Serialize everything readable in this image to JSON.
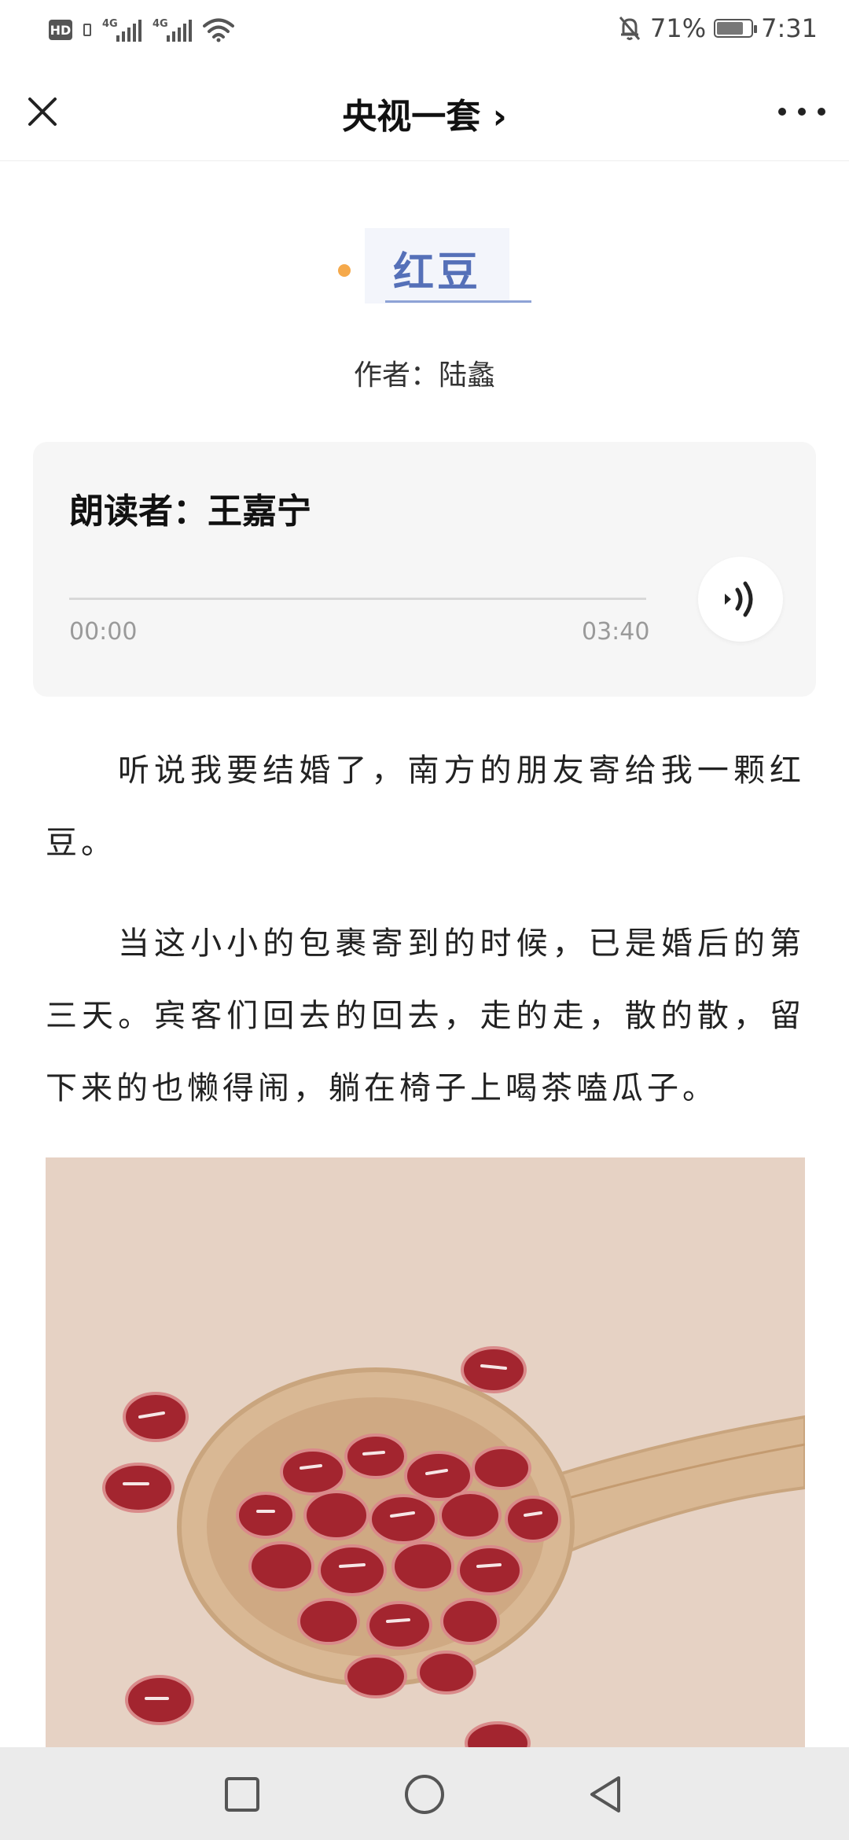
{
  "status_bar": {
    "hd_label": "HD",
    "sim1_label": "4G",
    "sim2_label": "4G",
    "battery_percent": "71%",
    "time": "7:31"
  },
  "header": {
    "title": "央视一套",
    "title_chevron": "›"
  },
  "article": {
    "title": "红豆",
    "author": "作者：陆蠡",
    "reader": "朗读者：王嘉宁",
    "audio": {
      "current_time": "00:00",
      "total_time": "03:40",
      "progress": 0
    },
    "paragraphs": [
      "听说我要结婚了，南方的朋友寄给我一颗红豆。",
      "当这小小的包裹寄到的时候，已是婚后的第三天。宾客们回去的回去，走的走，散的散，留下来的也懒得闹，躺在椅子上喝茶嗑瓜子。"
    ]
  },
  "colors": {
    "accent_blue": "#5570b8",
    "title_bg": "#f3f5fb",
    "dot_orange": "#f5a94b",
    "card_bg": "#f6f6f6",
    "bean_red": "#a3252f",
    "spoon_wood": "#d9b894",
    "image_bg": "#e6d2c4"
  },
  "icons": {
    "close": "close-icon",
    "more": "more-icon",
    "audio": "sound-wave-icon",
    "nav_recent": "square-icon",
    "nav_home": "circle-icon",
    "nav_back": "triangle-back-icon"
  }
}
